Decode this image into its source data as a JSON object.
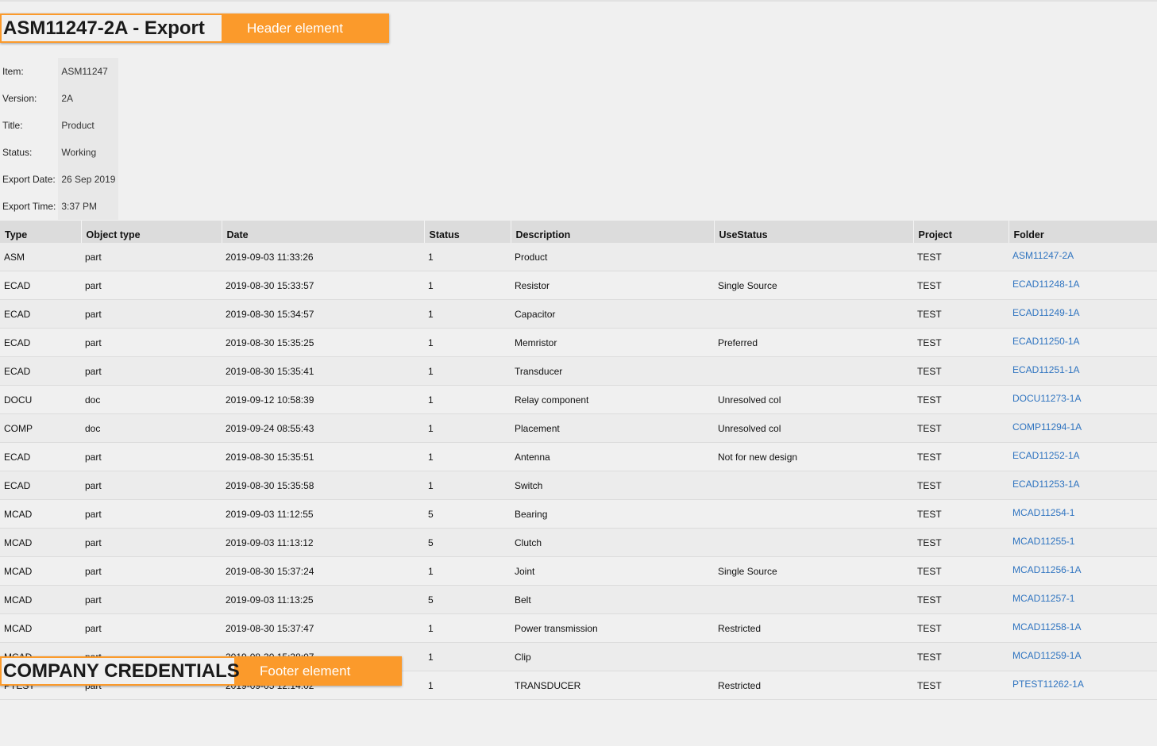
{
  "header": {
    "title": "ASM11247-2A - Export",
    "tag": "Header element"
  },
  "meta": [
    {
      "label": "Item:",
      "value": "ASM11247"
    },
    {
      "label": "Version:",
      "value": "2A"
    },
    {
      "label": "Title:",
      "value": "Product"
    },
    {
      "label": "Status:",
      "value": "Working"
    },
    {
      "label": "Export Date:",
      "value": "26 Sep 2019"
    },
    {
      "label": "Export Time:",
      "value": "3:37 PM"
    }
  ],
  "table": {
    "columns": [
      "Type",
      "Object type",
      "Date",
      "Status",
      "Description",
      "UseStatus",
      "Project",
      "Folder"
    ],
    "rows": [
      [
        "ASM",
        "part",
        "2019-09-03 11:33:26",
        "1",
        "Product",
        "",
        "TEST",
        "ASM11247-2A"
      ],
      [
        "ECAD",
        "part",
        "2019-08-30 15:33:57",
        "1",
        "Resistor",
        "Single Source",
        "TEST",
        "ECAD11248-1A"
      ],
      [
        "ECAD",
        "part",
        "2019-08-30 15:34:57",
        "1",
        "Capacitor",
        "",
        "TEST",
        "ECAD11249-1A"
      ],
      [
        "ECAD",
        "part",
        "2019-08-30 15:35:25",
        "1",
        "Memristor",
        "Preferred",
        "TEST",
        "ECAD11250-1A"
      ],
      [
        "ECAD",
        "part",
        "2019-08-30 15:35:41",
        "1",
        "Transducer",
        "",
        "TEST",
        "ECAD11251-1A"
      ],
      [
        "DOCU",
        "doc",
        "2019-09-12 10:58:39",
        "1",
        "Relay component",
        "Unresolved col",
        "TEST",
        "DOCU11273-1A"
      ],
      [
        "COMP",
        "doc",
        "2019-09-24 08:55:43",
        "1",
        "Placement",
        "Unresolved col",
        "TEST",
        "COMP11294-1A"
      ],
      [
        "ECAD",
        "part",
        "2019-08-30 15:35:51",
        "1",
        "Antenna",
        "Not for new design",
        "TEST",
        "ECAD11252-1A"
      ],
      [
        "ECAD",
        "part",
        "2019-08-30 15:35:58",
        "1",
        "Switch",
        "",
        "TEST",
        "ECAD11253-1A"
      ],
      [
        "MCAD",
        "part",
        "2019-09-03 11:12:55",
        "5",
        "Bearing",
        "",
        "TEST",
        "MCAD11254-1"
      ],
      [
        "MCAD",
        "part",
        "2019-09-03 11:13:12",
        "5",
        "Clutch",
        "",
        "TEST",
        "MCAD11255-1"
      ],
      [
        "MCAD",
        "part",
        "2019-08-30 15:37:24",
        "1",
        "Joint",
        "Single Source",
        "TEST",
        "MCAD11256-1A"
      ],
      [
        "MCAD",
        "part",
        "2019-09-03 11:13:25",
        "5",
        "Belt",
        "",
        "TEST",
        "MCAD11257-1"
      ],
      [
        "MCAD",
        "part",
        "2019-08-30 15:37:47",
        "1",
        "Power transmission",
        "Restricted",
        "TEST",
        "MCAD11258-1A"
      ],
      [
        "MCAD",
        "part",
        "2019-08-30 15:38:07",
        "1",
        "Clip",
        "",
        "TEST",
        "MCAD11259-1A"
      ],
      [
        "PTEST",
        "part",
        "2019-09-05 12:14:02",
        "1",
        "TRANSDUCER",
        "Restricted",
        "TEST",
        "PTEST11262-1A"
      ]
    ]
  },
  "footer": {
    "title": "COMPANY CREDENTIALS",
    "tag": "Footer element"
  },
  "colors": {
    "accent": "#fb9a2b",
    "link": "#2f74c0",
    "background": "#f0f0f0"
  }
}
